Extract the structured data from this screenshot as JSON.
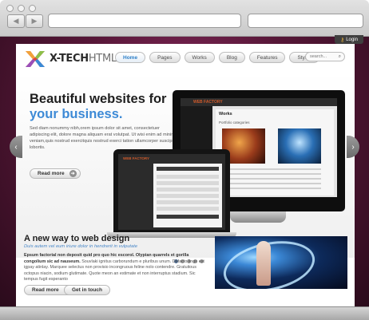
{
  "browser": {
    "back_icon": "back-arrow-icon",
    "forward_icon": "forward-arrow-icon",
    "back_glyph": "◀",
    "forward_glyph": "▶"
  },
  "site": {
    "login_label": "Login",
    "logo": {
      "brand": "X-TECH",
      "suffix": "HTML"
    },
    "nav": [
      "Home",
      "Pages",
      "Works",
      "Blog",
      "Features",
      "Styles"
    ],
    "search_placeholder": "search...",
    "hero": {
      "title_line1": "Beautiful websites for",
      "title_line2": "your business.",
      "text": "Sed diam nonummy nibh,orem ipsum dolor sit amet, consectetuer adipiscing elit, dolore magna aliquam erat volutpat. Ut wisi enim ad minim veniam,quis nostrud exercitquis nostrud exerci tation ullamcorper suscipit lobortis.",
      "read_more": "Read more"
    },
    "screens": {
      "monitor_logo": "WEB FACTORY",
      "monitor_title": "Works",
      "monitor_sub": "Portfolio categories",
      "laptop_logo": "WEB FACTORY"
    },
    "lower": {
      "title": "A new way to web design",
      "subtitle": "Duis autem vel eum iriure dolor in hendrerit in vulputate",
      "text_bold": "Epsum factorial non deposit quid pro quo hic escorol. Olypian quarrels et gorilla congolium sic ad nauseum.",
      "text": "Souvlaki ignitus carborundum e pluribus unum. Defacto lingo est igpay atinlay. Marquee selectus non provisio incongruous feline nolo contendre. Gratuitous octopus niacin, sodium glutimate. Quote meon an estimate et non interruptus stadium. Sic tempus fugit esperanto",
      "read_more": "Read more",
      "get_in_touch": "Get in touch"
    }
  },
  "colors": {
    "accent_blue": "#3d8ad6",
    "background_plum": "#571738"
  }
}
